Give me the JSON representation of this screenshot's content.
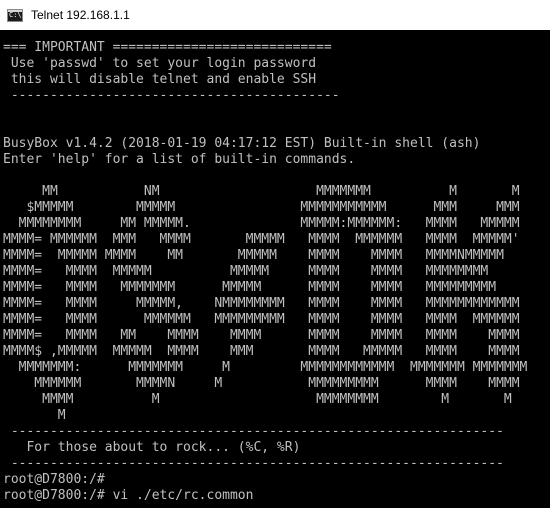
{
  "window": {
    "title": "Telnet 192.168.1.1",
    "icon": "console-icon",
    "colors": {
      "background": "#000000",
      "text": "#c0c0c0",
      "titlebar": "#ffffff"
    }
  },
  "terminal": {
    "lines": [
      "=== IMPORTANT ============================",
      " Use 'passwd' to set your login password",
      " this will disable telnet and enable SSH",
      " ------------------------------------------",
      "",
      "",
      "BusyBox v1.4.2 (2018-01-19 04:17:12 EST) Built-in shell (ash)",
      "Enter 'help' for a list of built-in commands.",
      "",
      "     MM           NM                    MMMMMMM          M       M",
      "   $MMMMM        MMMMM                MMMMMMMMMMM      MMM     MMM",
      "  MMMMMMMM     MM MMMMM.              MMMMM:MMMMMM:   MMMM   MMMMM",
      "MMMM= MMMMMM  MMM   MMMM       MMMMM   MMMM  MMMMMM   MMMM  MMMMM'",
      "MMMM=  MMMMM MMMM    MM       MMMMM    MMMM    MMMM   MMMMNMMMMM",
      "MMMM=   MMMM  MMMMM          MMMMM     MMMM    MMMM   MMMMMMMM",
      "MMMM=   MMMM   MMMMMMM      MMMMM      MMMM    MMMM   MMMMMMMMM",
      "MMMM=   MMMM     MMMMM,    NMMMMMMMM   MMMM    MMMM   MMMMMMMMMMMM",
      "MMMM=   MMMM      MMMMMM   MMMMMMMMM   MMMM    MMMM   MMMM  MMMMMM",
      "MMMM=   MMMM   MM    MMMM    MMMM      MMMM    MMMM   MMMM    MMMM",
      "MMMM$ ,MMMMM  MMMMM  MMMM    MMM       MMMM   MMMMM   MMMM    MMMM",
      "  MMMMMMM:      MMMMMMM     M         MMMMMMMMMMMM  MMMMMMM MMMMMMM",
      "    MMMMMM       MMMMN     M           MMMMMMMMM      MMMM    MMMM",
      "     MMMM          M                    MMMMMMMM        M       M",
      "       M",
      " ---------------------------------------------------------------",
      "   For those about to rock... (%C, %R)",
      " ---------------------------------------------------------------",
      "root@D7800:/#",
      "root@D7800:/# vi ./etc/rc.common"
    ]
  }
}
